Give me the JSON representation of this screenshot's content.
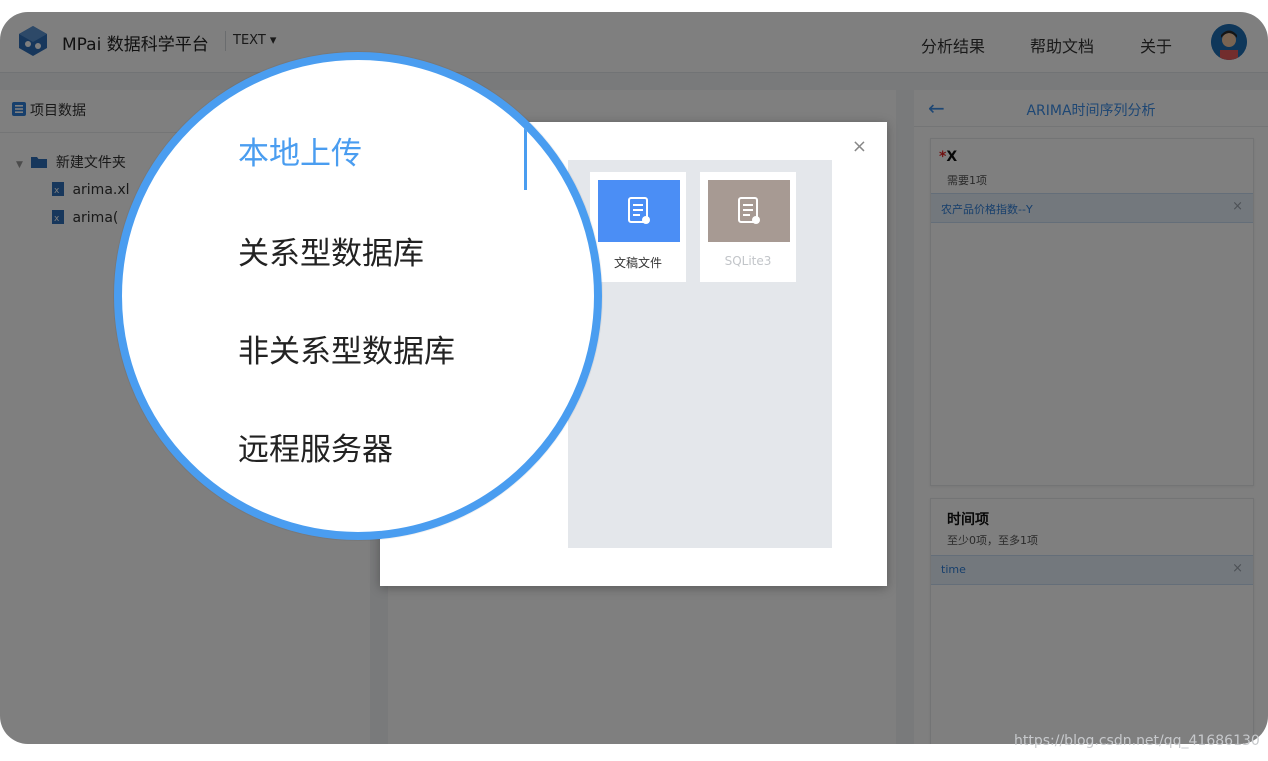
{
  "app": {
    "title": "MPai 数据科学平台",
    "mode": "TEXT ▾"
  },
  "nav": {
    "items": [
      "分析结果",
      "帮助文档",
      "关于"
    ]
  },
  "project": {
    "title": "项目数据",
    "folder": "新建文件夹",
    "files": [
      "arima.xl",
      "arima("
    ]
  },
  "analysis": {
    "back_icon": "back-arrow-icon",
    "title": "ARIMA时间序列分析",
    "x_card": {
      "required_mark": "*",
      "title": "X",
      "subtitle": "需要1项",
      "tag": "农产品价格指数--Y"
    },
    "time_card": {
      "title": "时间项",
      "subtitle": "至少0项，至多1项",
      "tag": "time"
    }
  },
  "upload_dialog": {
    "close": "×",
    "sources": [
      "本地上传",
      "关系型数据库",
      "非关系型数据库",
      "远程服务器"
    ],
    "selected_source": "本地上传",
    "tiles": [
      {
        "label": "文稿文件",
        "icon": "document-icon",
        "color": "#4b8ef5"
      },
      {
        "label": "SQLite3",
        "icon": "document-icon",
        "color": "#a79a93"
      }
    ]
  },
  "colors": {
    "accent": "#4a9df0",
    "link": "#3d8ee8",
    "required": "#e02020"
  },
  "watermark": "https://blog.csdn.net/qq_41686130"
}
